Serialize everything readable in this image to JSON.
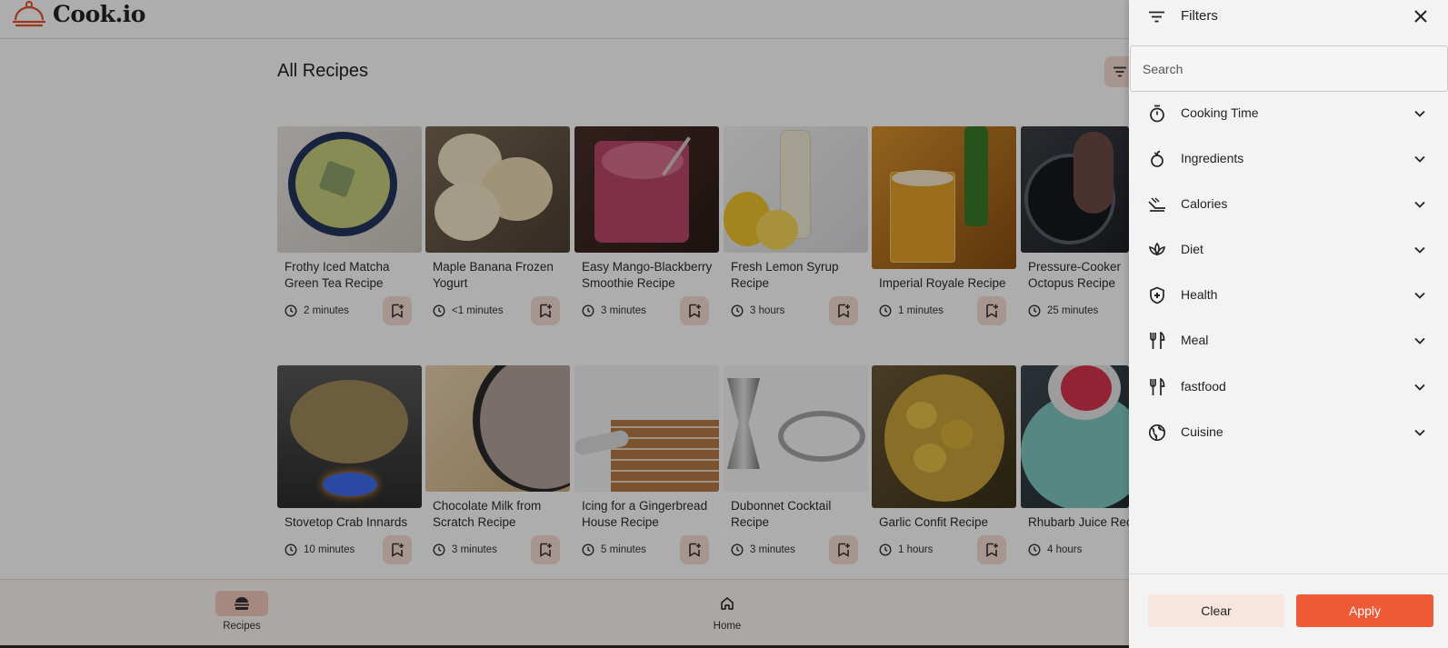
{
  "app": {
    "logo_text": "Cook.io"
  },
  "main": {
    "title": "All Recipes"
  },
  "recipes": [
    {
      "title": "Frothy Iced Matcha Green Tea Recipe",
      "time": "2 minutes"
    },
    {
      "title": "Maple Banana Frozen Yogurt",
      "time": "<1 minutes"
    },
    {
      "title": "Easy Mango-Blackberry Smoothie Recipe",
      "time": "3 minutes"
    },
    {
      "title": "Fresh Lemon Syrup Recipe",
      "time": "3 hours"
    },
    {
      "title": "Imperial Royale Recipe",
      "time": "1 minutes"
    },
    {
      "title": "Pressure-Cooker Octopus Recipe",
      "time": "25 minutes"
    },
    {
      "title": "Stovetop Crab Innards",
      "time": "10 minutes"
    },
    {
      "title": "Chocolate Milk from Scratch Recipe",
      "time": "3 minutes"
    },
    {
      "title": "Icing for a Gingerbread House Recipe",
      "time": "5 minutes"
    },
    {
      "title": "Dubonnet Cocktail Recipe",
      "time": "3 minutes"
    },
    {
      "title": "Garlic Confit Recipe",
      "time": "1 hours"
    },
    {
      "title": "Rhubarb Juice Recipe",
      "time": "4 hours"
    }
  ],
  "bottom_nav": {
    "recipes_label": "Recipes",
    "home_label": "Home"
  },
  "filters": {
    "title": "Filters",
    "search_placeholder": "Search",
    "items": [
      {
        "label": "Cooking Time",
        "icon": "timer-icon"
      },
      {
        "label": "Ingredients",
        "icon": "ingredients-icon"
      },
      {
        "label": "Calories",
        "icon": "calories-icon"
      },
      {
        "label": "Diet",
        "icon": "diet-icon"
      },
      {
        "label": "Health",
        "icon": "health-icon"
      },
      {
        "label": "Meal",
        "icon": "meal-icon"
      },
      {
        "label": "fastfood",
        "icon": "fastfood-icon"
      },
      {
        "label": "Cuisine",
        "icon": "cuisine-icon"
      }
    ],
    "clear_label": "Clear",
    "apply_label": "Apply"
  },
  "colors": {
    "accent": "#ee5a35",
    "accent_soft": "#f7ddd4",
    "overlay": "rgba(0,0,0,0.32)"
  }
}
